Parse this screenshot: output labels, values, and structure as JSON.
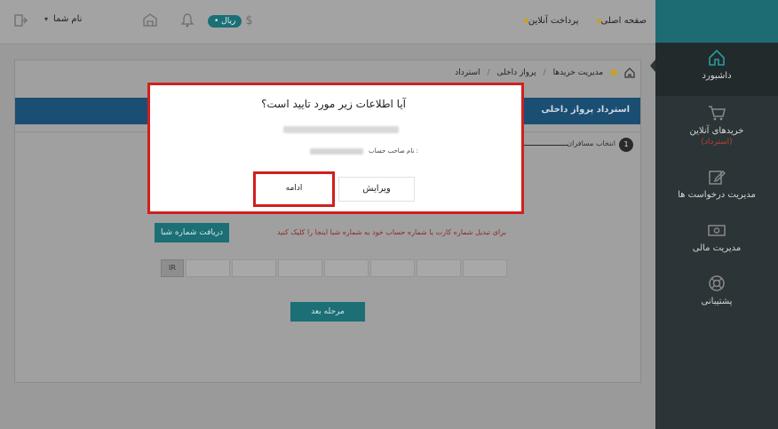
{
  "topbar": {
    "nav": [
      "صفحه اصلی",
      "پرداخت آنلاین"
    ],
    "wallet_label": "• ریال",
    "currency_symbol": "$",
    "user_label": "نام شما"
  },
  "sidebar": {
    "items": [
      {
        "label": "داشبورد",
        "icon": "home-icon"
      },
      {
        "label": "خریدهای آنلاین",
        "sub": "(استرداد)",
        "icon": "cart-icon"
      },
      {
        "label": "مدیریت درخواست ها",
        "icon": "edit-icon"
      },
      {
        "label": "مدیریت مالی",
        "icon": "money-icon"
      },
      {
        "label": "پشتیبانی",
        "icon": "support-icon"
      }
    ]
  },
  "breadcrumb": [
    "مدیریت خریدها",
    "پرواز داخلی",
    "استرداد"
  ],
  "page": {
    "header_title": "استرداد پرواز داخلی",
    "step_number": "1",
    "step_label": "انتخاب مسافران",
    "fetch_button": "دریافت شماره شبا",
    "hint": "برای تبدیل شماره کارت یا شماره حساب خود به شماره شبا اینجا را کلیک کنید",
    "iban_prefix": "IR",
    "next_button": "مرحله بعد"
  },
  "modal": {
    "title": "آیا اطلاعات زیر مورد تایید است؟",
    "account_holder_label": "نام صاحب حساب :",
    "continue_label": "ادامه",
    "edit_label": "ویرایش"
  },
  "colors": {
    "sidebar_bg": "#2b3437",
    "teal": "#1b6f75",
    "modal_highlight": "#d11f1f"
  }
}
